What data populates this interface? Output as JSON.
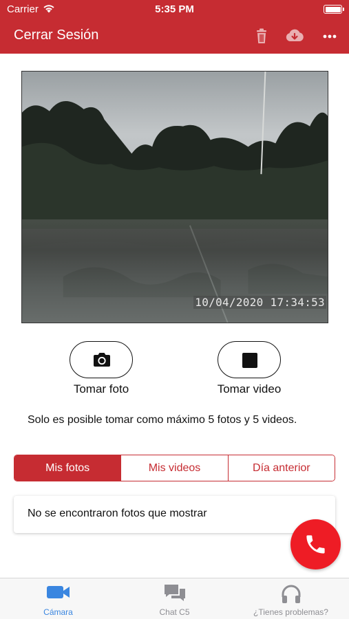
{
  "status_bar": {
    "carrier": "Carrier",
    "time": "5:35 PM",
    "icons": [
      "wifi-icon",
      "battery-icon"
    ]
  },
  "nav_bar": {
    "title": "Cerrar Sesión",
    "icons": [
      "trash-icon",
      "cloud-download-icon",
      "more-icon"
    ],
    "color": "#c62c32"
  },
  "camera_feed": {
    "timestamp": "10/04/2020 17:34:53"
  },
  "actions": {
    "photo_label": "Tomar foto",
    "video_label": "Tomar video",
    "icons": [
      "camera-icon",
      "stop-icon"
    ]
  },
  "notice": "Solo es posible tomar como máximo 5 fotos y 5 videos.",
  "segments": {
    "items": [
      {
        "label": "Mis fotos",
        "active": true
      },
      {
        "label": "Mis videos",
        "active": false
      },
      {
        "label": "Día anterior",
        "active": false
      }
    ]
  },
  "empty_state": "No se encontraron fotos que mostrar",
  "call_button": {
    "icon": "phone-icon",
    "color": "#ee1c25"
  },
  "tab_bar": {
    "items": [
      {
        "label": "Cámara",
        "icon": "video-camera-icon",
        "active": true
      },
      {
        "label": "Chat C5",
        "icon": "chat-icon",
        "active": false
      },
      {
        "label": "¿Tienes problemas?",
        "icon": "headphones-icon",
        "active": false
      }
    ],
    "active_color": "#3a86e0"
  }
}
